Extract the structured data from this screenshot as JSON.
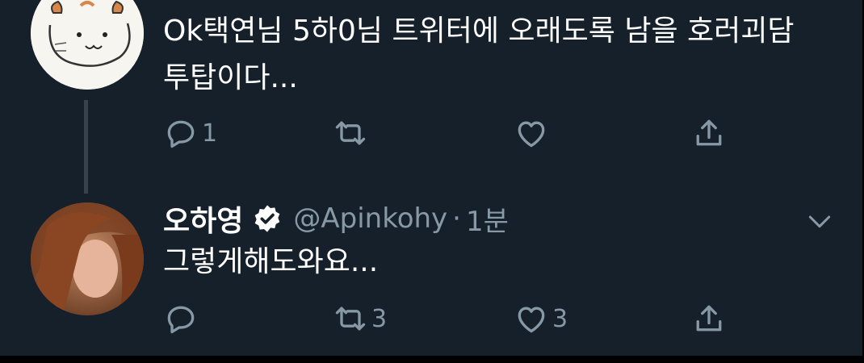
{
  "tweet1": {
    "text_line1": "Ok택연님 5하0님 트위터에 오래도록 남을 호러괴담",
    "text_line2": "투탑이다...",
    "actions": {
      "reply_count": "1",
      "retweet_count": "",
      "like_count": ""
    }
  },
  "tweet2": {
    "display_name": "오하영",
    "handle": "@Apinkohy",
    "separator": "·",
    "time": "1분",
    "text": "그렇게해도와요...",
    "actions": {
      "reply_count": "",
      "retweet_count": "3",
      "like_count": "3"
    }
  },
  "colors": {
    "background": "#15202b",
    "text_primary": "#ffffff",
    "text_secondary": "#8899a6",
    "thread_line": "#38444d"
  },
  "icons": [
    "reply-icon",
    "retweet-icon",
    "like-icon",
    "share-icon",
    "verified-badge-icon",
    "chevron-down-icon"
  ]
}
